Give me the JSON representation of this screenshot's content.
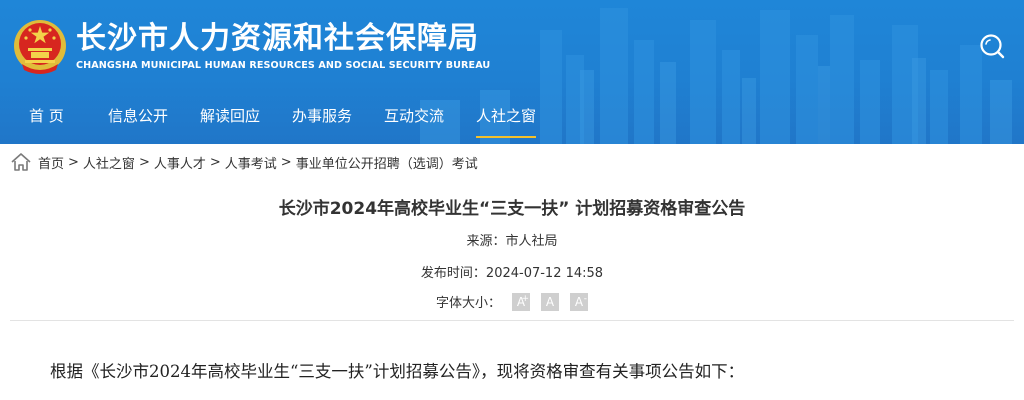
{
  "header": {
    "title_cn": "长沙市人力资源和社会保障局",
    "title_en": "CHANGSHA MUNICIPAL HUMAN RESOURCES AND SOCIAL SECURITY BUREAU",
    "emblem_icon": "national-emblem-icon",
    "search_icon": "search-icon",
    "colors": {
      "primary": "#1f80d2",
      "accent": "#f5c02a"
    }
  },
  "nav": {
    "items": [
      {
        "label": "首 页"
      },
      {
        "label": "信息公开"
      },
      {
        "label": "解读回应"
      },
      {
        "label": "办事服务"
      },
      {
        "label": "互动交流"
      },
      {
        "label": "人社之窗"
      }
    ],
    "active": "人社之窗"
  },
  "breadcrumb": {
    "home_icon": "home-icon",
    "items": [
      "首页",
      "人社之窗",
      "人事人才",
      "人事考试",
      "事业单位公开招聘（选调）考试"
    ],
    "separator": ">"
  },
  "article": {
    "title": "长沙市2024年高校毕业生“三支一扶” 计划招募资格审查公告",
    "source_label": "来源：",
    "source_value": "市人社局",
    "time_label": "发布时间：",
    "time_value": "2024-07-12 14:58",
    "font_size_label": "字体大小：",
    "font_size_buttons": [
      "A",
      "A",
      "A"
    ],
    "body_first_line": "根据《长沙市2024年高校毕业生“三支一扶”计划招募公告》，现将资格审查有关事项公告如下："
  }
}
